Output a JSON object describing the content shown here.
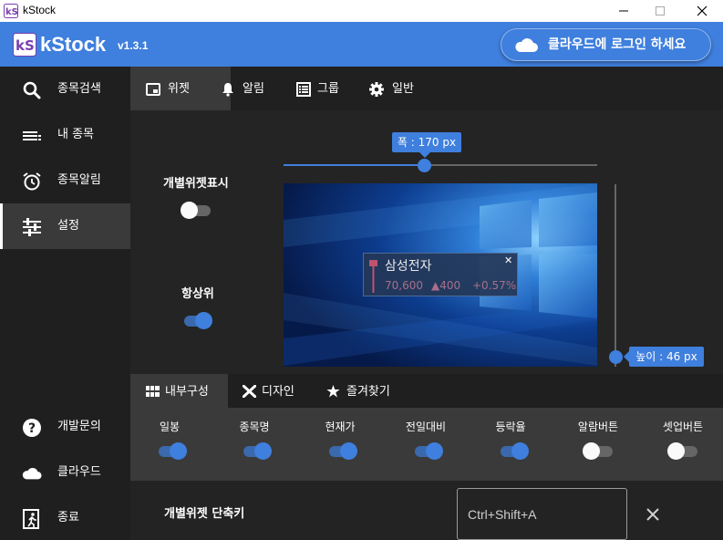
{
  "window": {
    "title": "kStock",
    "logo_text": "kS"
  },
  "header": {
    "app_name": "kStock",
    "version": "v1.3.1",
    "login_label": "클라우드에 로그인 하세요"
  },
  "sidebar": {
    "items": [
      {
        "label": "종목검색",
        "icon": "search-icon"
      },
      {
        "label": "내 종목",
        "icon": "list-icon"
      },
      {
        "label": "종목알림",
        "icon": "alarm-clock-icon"
      },
      {
        "label": "설정",
        "icon": "sliders-icon",
        "active": true
      }
    ],
    "bottom_items": [
      {
        "label": "개발문의",
        "icon": "question-icon"
      },
      {
        "label": "클라우드",
        "icon": "cloud-icon"
      },
      {
        "label": "종료",
        "icon": "exit-icon"
      }
    ]
  },
  "top_tabs": [
    {
      "label": "위젯",
      "icon": "widget-icon",
      "active": true
    },
    {
      "label": "알림",
      "icon": "bell-icon"
    },
    {
      "label": "그룹",
      "icon": "table-icon"
    },
    {
      "label": "일반",
      "icon": "gear-icon"
    }
  ],
  "widget_settings": {
    "width_label": "폭 : 170 px",
    "width_value": 170,
    "width_fraction": 0.45,
    "height_label": "높이 : 46 px",
    "height_value": 46,
    "height_fraction": 0.0,
    "individual_widget_label": "개별위젯표시",
    "individual_widget_on": false,
    "always_on_top_label": "항상위",
    "always_on_top_on": true
  },
  "preview_widget": {
    "name": "삼성전자",
    "close": "✕",
    "price": "70,600",
    "change": "▲400",
    "change_pct": "+0.57%",
    "color": "#a86f8a"
  },
  "sub_tabs": [
    {
      "label": "내부구성",
      "icon": "grid-icon",
      "active": true
    },
    {
      "label": "디자인",
      "icon": "tools-icon"
    },
    {
      "label": "즐겨찾기",
      "icon": "star-icon"
    }
  ],
  "components": [
    {
      "label": "일봉",
      "on": true
    },
    {
      "label": "종목명",
      "on": true
    },
    {
      "label": "현재가",
      "on": true
    },
    {
      "label": "전일대비",
      "on": true
    },
    {
      "label": "등락율",
      "on": true
    },
    {
      "label": "알람버튼",
      "on": false
    },
    {
      "label": "셋업버튼",
      "on": false
    }
  ],
  "hotkey": {
    "label": "개별위젯 단축키",
    "placeholder": "Ctrl+Shift+A"
  },
  "colors": {
    "accent": "#3f7fdd",
    "sidebar_bg": "#1f1f1f",
    "panel_bg": "#3a3a3a"
  }
}
